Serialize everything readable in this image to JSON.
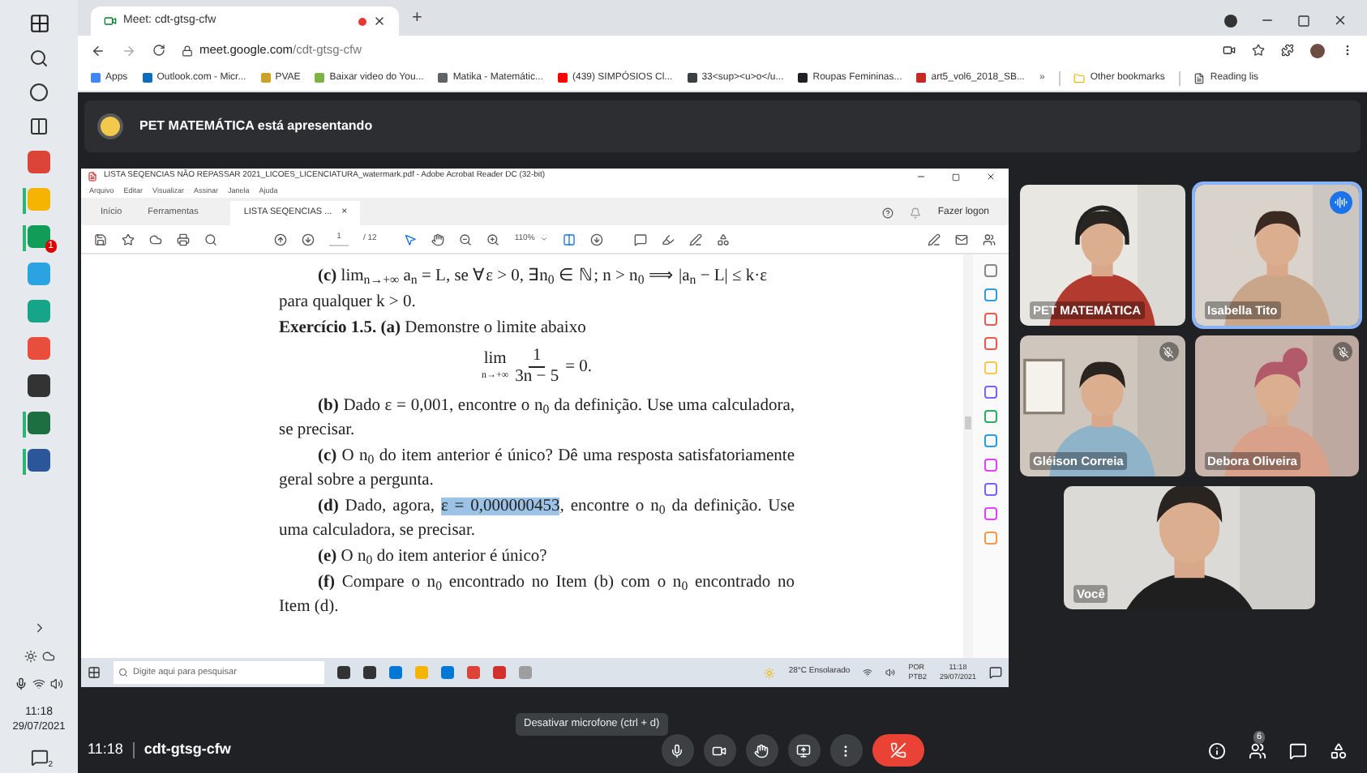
{
  "os_taskbar": {
    "apps": [
      {
        "kind": "chrome",
        "active": false
      },
      {
        "kind": "folder",
        "active": true
      },
      {
        "kind": "store",
        "active": true,
        "badge": "1"
      },
      {
        "kind": "telegram",
        "active": false
      },
      {
        "kind": "app",
        "active": false
      },
      {
        "kind": "paint",
        "active": false
      },
      {
        "kind": "notes",
        "active": false
      },
      {
        "kind": "excel",
        "active": true
      },
      {
        "kind": "word",
        "active": true
      }
    ],
    "time": "11:18",
    "date": "29/07/2021",
    "notification_count": "2"
  },
  "browser": {
    "tab_title": "Meet: cdt-gtsg-cfw",
    "new_tab": "+",
    "url_host": "meet.google.com",
    "url_path": "/cdt-gtsg-cfw",
    "bookmarks": [
      {
        "label": "Apps",
        "color": "#4285f4"
      },
      {
        "label": "Outlook.com - Micr...",
        "color": "#0f6cbd"
      },
      {
        "label": "PVAE",
        "color": "#c9a227"
      },
      {
        "label": "Baixar video do You...",
        "color": "#7cb342"
      },
      {
        "label": "Matika - Matemátic...",
        "color": "#5f6368"
      },
      {
        "label": "(439) SIMPÓSIOS Cl...",
        "color": "#ff0000"
      },
      {
        "label": "33<sup><u>o</u...",
        "color": "#3c4043"
      },
      {
        "label": "Roupas Femininas...",
        "color": "#202124"
      },
      {
        "label": "art5_vol6_2018_SB...",
        "color": "#c62828"
      }
    ],
    "more": "»",
    "other_bookmarks": "Other bookmarks",
    "reading_list": "Reading lis"
  },
  "meet": {
    "presenting_banner": "PET MATEMÁTICA está apresentando",
    "acrobat": {
      "title": "LISTA SEQENCIAS  NÃO REPASSAR 2021_LICOES_LICENCIATURA_watermark.pdf - Adobe Acrobat Reader DC (32-bit)",
      "menu": [
        "Arquivo",
        "Editar",
        "Visualizar",
        "Assinar",
        "Janela",
        "Ajuda"
      ],
      "tabs": [
        {
          "label": "Início",
          "selected": false
        },
        {
          "label": "Ferramentas",
          "selected": false
        },
        {
          "label": "LISTA SEQENCIAS ...",
          "selected": true
        }
      ],
      "tab_close": "×",
      "sign_in": "Fazer logon",
      "page": "1",
      "page_total": "/ 12",
      "zoom": "110%",
      "blocks": [
        {
          "kind": "para",
          "indent": true,
          "text": "**(c)** lim$_{n→+∞}$ a$_{n}$ = L, se ∀ε > 0, ∃n$_{0}$ ∈ ℕ; n > n$_{0}$ ⟹ |a$_{n}$ − L| ≤ k·ε"
        },
        {
          "kind": "para",
          "indent": false,
          "text": "para qualquer k > 0."
        },
        {
          "kind": "para",
          "indent": false,
          "text": "**Exercício 1.5.** **(a)** Demonstre o limite abaixo"
        },
        {
          "kind": "display",
          "lim": "lim",
          "under": "n→+∞",
          "numerator": "1",
          "denominator": "3n − 5",
          "rhs": "= 0."
        },
        {
          "kind": "para",
          "indent": true,
          "text": "**(b)** Dado ε = 0,001, encontre o n$_{0}$ da definição. Use uma calculadora, se precisar."
        },
        {
          "kind": "para",
          "indent": true,
          "text": "**(c)** O n$_{0}$ do item anterior é único? Dê uma resposta satisfatoriamente geral sobre a pergunta."
        },
        {
          "kind": "para",
          "indent": true,
          "segments": [
            {
              "text": "**(d)** Dado, agora, ",
              "selected": false
            },
            {
              "text": "ε = 0,000000453",
              "selected": true
            },
            {
              "text": ", encontre o n$_{0}$ da definição. Use uma calculadora, se precisar.",
              "selected": false
            }
          ]
        },
        {
          "kind": "para",
          "indent": true,
          "text": "**(e)** O n$_{0}$ do item anterior é único?"
        },
        {
          "kind": "para",
          "indent": true,
          "text": "**(f)** Compare o n$_{0}$ encontrado no Item (b) com o n$_{0}$ encontrado no Item (d)."
        }
      ],
      "win_taskbar": {
        "search_placeholder": "Digite aqui para pesquisar",
        "weather": "28°C Ensolarado",
        "language": "POR",
        "layout": "PTB2",
        "time": "11:18",
        "date": "29/07/2021"
      }
    },
    "tooltip": "Desativar microfone (ctrl + d)",
    "tiles": [
      {
        "name": "PET MATEMÁTICA",
        "speaking": false,
        "muted": false
      },
      {
        "name": "Isabella Tito",
        "speaking": true,
        "muted": false
      },
      {
        "name": "Gléison Correia",
        "speaking": false,
        "muted": true
      },
      {
        "name": "Debora Oliveira",
        "speaking": false,
        "muted": true
      },
      {
        "name": "Você",
        "speaking": false,
        "muted": false
      }
    ],
    "bottom": {
      "time": "11:18",
      "meeting_code": "cdt-gtsg-cfw",
      "participant_count": "6"
    }
  }
}
